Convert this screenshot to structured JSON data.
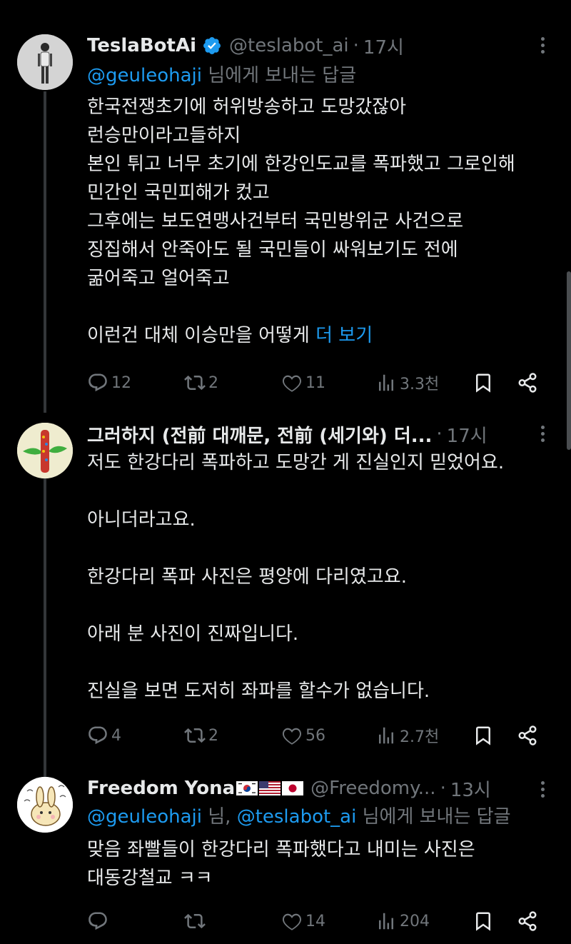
{
  "tweets": [
    {
      "name": "TeslaBotAi",
      "handle": "@teslabot_ai",
      "time": "17시",
      "replying_mention": "@geuleohaji",
      "replying_suffix": " 님에게 보내는 답글",
      "lines": [
        "한국전쟁초기에 허위방송하고 도망갔잖아",
        "런승만이라고들하지",
        "본인 튀고 너무 초기에 한강인도교를 폭파했고 그로인해",
        "민간인 국민피해가 컸고",
        "그후에는 보도연맹사건부터 국민방위군 사건으로",
        "징집해서 안죽아도 될 국민들이 싸워보기도 전에",
        "굶어죽고 얼어죽고",
        "",
        "이런건 대체 이승만을 어떻게 "
      ],
      "show_more": "더 보기",
      "replies": "12",
      "reposts": "2",
      "likes": "11",
      "views": "3.3천"
    },
    {
      "name": "그러하지 (전前 대깨문, 전前 (세기와) 더...",
      "time": "17시",
      "lines": [
        "저도 한강다리 폭파하고 도망간 게 진실인지 믿었어요.",
        "",
        "아니더라고요.",
        "",
        "한강다리 폭파 사진은 평양에 다리였고요.",
        "",
        "아래 분 사진이 진짜입니다.",
        "",
        "진실을 보면 도저히 좌파를 할수가 없습니다."
      ],
      "replies": "4",
      "reposts": "2",
      "likes": "56",
      "views": "2.7천"
    },
    {
      "name": "Freedom Yona",
      "handle": "@Freedomy...",
      "time": "13시",
      "replying_mention_1": "@geuleohaji",
      "replying_middle": " 님, ",
      "replying_mention_2": "@teslabot_ai",
      "replying_suffix": " 님에게 보내는 답글",
      "lines": [
        "맞음 좌빨들이 한강다리 폭파했다고 내미는 사진은",
        "대동강철교 ㅋㅋ"
      ],
      "replies": "",
      "reposts": "",
      "likes": "14",
      "views": "204"
    }
  ],
  "icons": {
    "reply": "reply-icon",
    "repost": "repost-icon",
    "like": "heart-icon",
    "views": "views-icon",
    "bookmark": "bookmark-icon",
    "share": "share-icon",
    "verified": "verified-badge-icon",
    "more": "more-options-icon"
  },
  "colors": {
    "accent": "#1d9bf0",
    "muted": "#71767b",
    "text": "#e7e9ea",
    "background": "#000000"
  }
}
